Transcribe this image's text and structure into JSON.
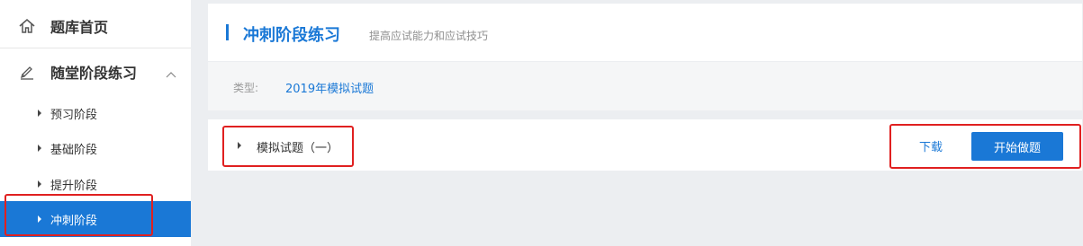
{
  "sidebar": {
    "home": {
      "label": "题库首页",
      "icon": "home-icon"
    },
    "practice": {
      "label": "随堂阶段练习",
      "icon": "pencil-icon",
      "expanded": true
    },
    "items": [
      {
        "label": "预习阶段",
        "active": false
      },
      {
        "label": "基础阶段",
        "active": false
      },
      {
        "label": "提升阶段",
        "active": false
      },
      {
        "label": "冲刺阶段",
        "active": true
      }
    ]
  },
  "header": {
    "title": "冲刺阶段练习",
    "subtitle": "提高应试能力和应试技巧"
  },
  "filter": {
    "type_label": "类型:",
    "type_value": "2019年模拟试题"
  },
  "paper": {
    "name": "模拟试题（一）",
    "download_label": "下载",
    "start_label": "开始做题"
  },
  "colors": {
    "accent": "#1a78d6",
    "annotation": "#e02020",
    "background": "#eceef1"
  }
}
